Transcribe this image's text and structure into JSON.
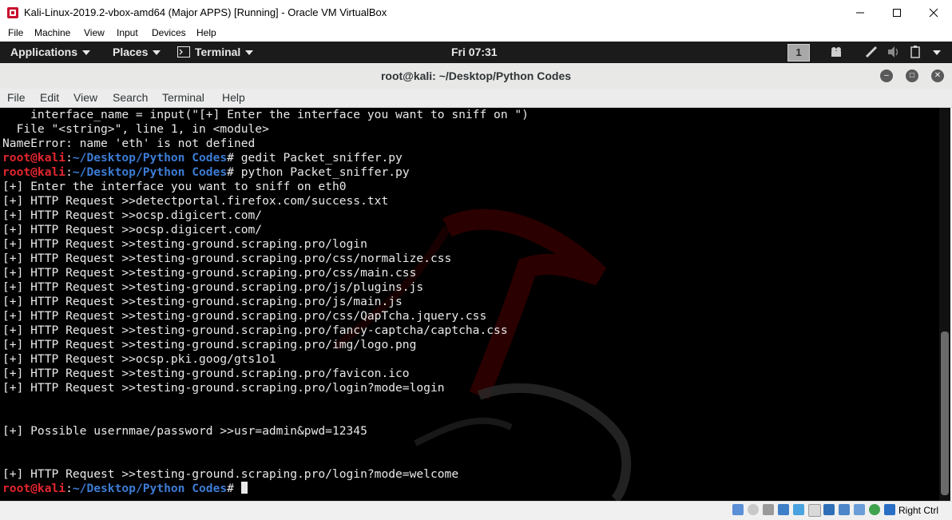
{
  "vbox": {
    "title": "Kali-Linux-2019.2-vbox-amd64 (Major APPS) [Running] - Oracle VM VirtualBox",
    "menu": [
      "File",
      "Machine",
      "View",
      "Input",
      "Devices",
      "Help"
    ],
    "host_key": "Right Ctrl"
  },
  "panel": {
    "applications": "Applications",
    "places": "Places",
    "terminal": "Terminal",
    "clock": "Fri 07:31",
    "workspace": "1"
  },
  "terminal": {
    "title": "root@kali: ~/Desktop/Python Codes",
    "menu": [
      "File",
      "Edit",
      "View",
      "Search",
      "Terminal",
      "Help"
    ],
    "prompt_user": "root@kali",
    "prompt_sep": ":",
    "prompt_path": "~/Desktop/Python Codes",
    "prompt_sym": "#",
    "lines": [
      "    interface_name = input(\"[+] Enter the interface you want to sniff on \")",
      "  File \"<string>\", line 1, in <module>",
      "NameError: name 'eth' is not defined",
      " gedit Packet_sniffer.py",
      " python Packet_sniffer.py",
      "[+] Enter the interface you want to sniff on eth0",
      "[+] HTTP Request >>detectportal.firefox.com/success.txt",
      "[+] HTTP Request >>ocsp.digicert.com/",
      "[+] HTTP Request >>ocsp.digicert.com/",
      "[+] HTTP Request >>testing-ground.scraping.pro/login",
      "[+] HTTP Request >>testing-ground.scraping.pro/css/normalize.css",
      "[+] HTTP Request >>testing-ground.scraping.pro/css/main.css",
      "[+] HTTP Request >>testing-ground.scraping.pro/js/plugins.js",
      "[+] HTTP Request >>testing-ground.scraping.pro/js/main.js",
      "[+] HTTP Request >>testing-ground.scraping.pro/css/QapTcha.jquery.css",
      "[+] HTTP Request >>testing-ground.scraping.pro/fancy-captcha/captcha.css",
      "[+] HTTP Request >>testing-ground.scraping.pro/img/logo.png",
      "[+] HTTP Request >>ocsp.pki.goog/gts1o1",
      "[+] HTTP Request >>testing-ground.scraping.pro/favicon.ico",
      "[+] HTTP Request >>testing-ground.scraping.pro/login?mode=login",
      "",
      "",
      "[+] Possible usernmae/password >>usr=admin&pwd=12345",
      "",
      "",
      "[+] HTTP Request >>testing-ground.scraping.pro/login?mode=welcome",
      " "
    ]
  }
}
